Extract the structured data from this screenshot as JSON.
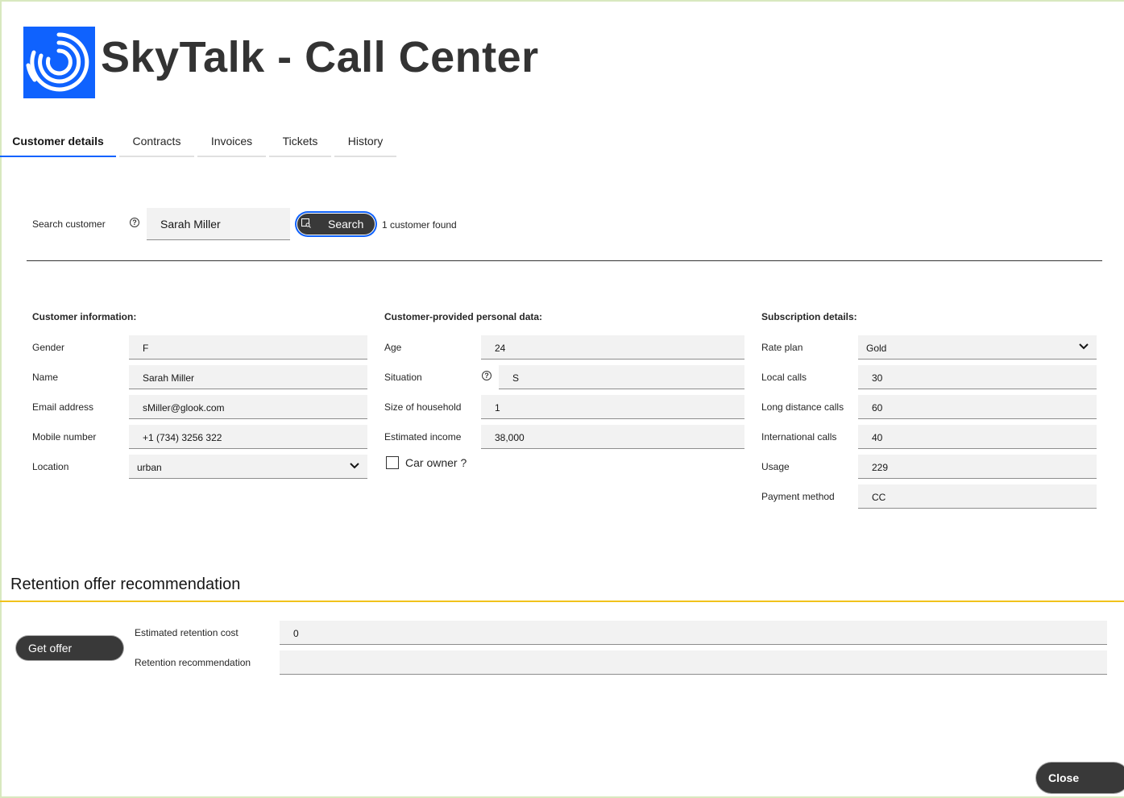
{
  "app": {
    "title": "SkyTalk - Call Center",
    "logo_icon": "skytalk-swirl-logo",
    "brand_color": "#0f62fe"
  },
  "tabs": [
    {
      "label": "Customer details",
      "active": true
    },
    {
      "label": "Contracts",
      "active": false
    },
    {
      "label": "Invoices",
      "active": false
    },
    {
      "label": "Tickets",
      "active": false
    },
    {
      "label": "History",
      "active": false
    }
  ],
  "search": {
    "label": "Search customer",
    "help_icon": "question-circle-icon",
    "value": "Sarah Miller",
    "button_label": "Search",
    "button_icon": "search-icon",
    "result": "1 customer found"
  },
  "customer_info": {
    "title": "Customer information:",
    "fields": [
      {
        "label": "Gender",
        "value": "F"
      },
      {
        "label": "Name",
        "value": "Sarah Miller"
      },
      {
        "label": "Email address",
        "value": "sMiller@glook.com"
      },
      {
        "label": "Mobile number",
        "value": "+1 (734) 3256 322"
      },
      {
        "label": "Location",
        "value": "urban"
      }
    ]
  },
  "personal_data": {
    "title": "Customer-provided personal data:",
    "fields": [
      {
        "label": "Age",
        "value": "24"
      },
      {
        "label": "Situation",
        "value": "S"
      },
      {
        "label": "Size of household",
        "value": "1"
      },
      {
        "label": "Estimated income",
        "value": "38,000"
      }
    ],
    "car_owner_label": "Car owner ?",
    "car_owner_checked": false
  },
  "subscription": {
    "title": "Subscription details:",
    "fields": [
      {
        "label": "Rate plan",
        "value": "Gold"
      },
      {
        "label": "Local calls",
        "value": "30"
      },
      {
        "label": "Long distance calls",
        "value": "60"
      },
      {
        "label": "International calls",
        "value": "40"
      },
      {
        "label": "Usage",
        "value": "229"
      },
      {
        "label": "Payment method",
        "value": "CC"
      }
    ]
  },
  "retention": {
    "title": "Retention offer recommendation",
    "button_label": "Get offer",
    "cost_label": "Estimated retention cost",
    "cost_value": "0",
    "recommendation_label": "Retention recommendation",
    "recommendation_value": "",
    "accent_color": "#f1c21b"
  },
  "close_label": "Close"
}
